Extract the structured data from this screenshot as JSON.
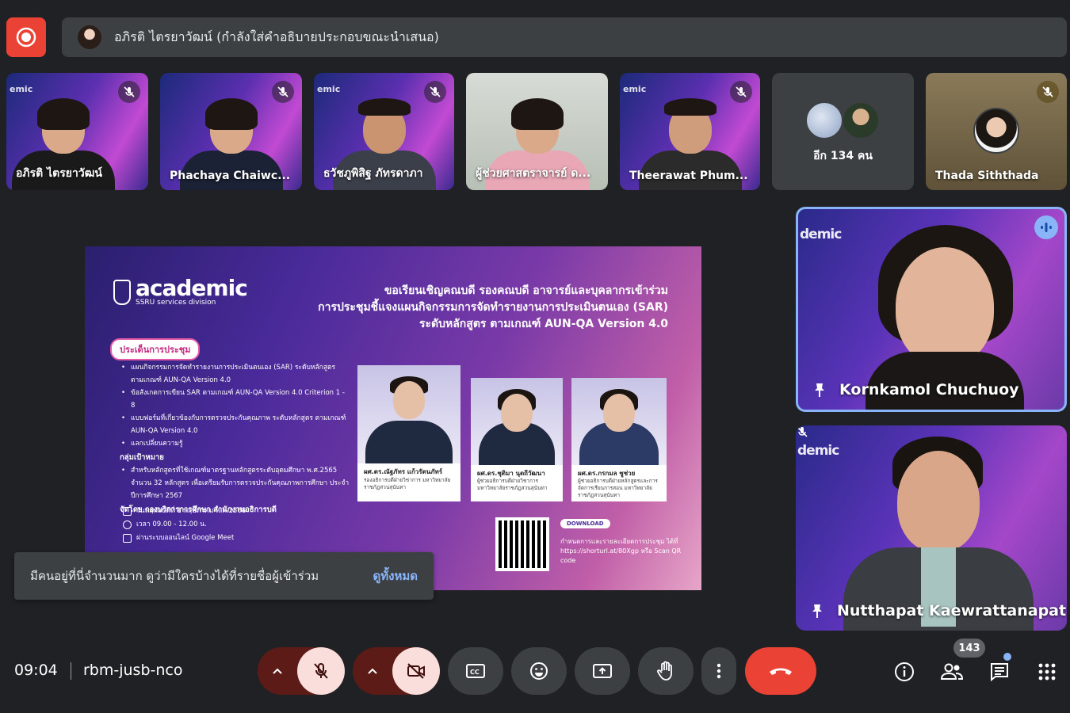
{
  "presenter": {
    "text": "อภิรติ ไตรยาวัฒน์ (กำลังใส่คำอธิบายประกอบขณะนำเสนอ)"
  },
  "tiles": [
    {
      "name": "อภิรติ ไตรยาวัฒน์"
    },
    {
      "name": "Phachaya Chaiwc..."
    },
    {
      "name": "ธวัชภูพิสิฐ ภัทรดาภา"
    },
    {
      "name": "ผู้ช่วยศาสตราจารย์ ด..."
    },
    {
      "name": "Theerawat Phum..."
    },
    {
      "name": "อีก 134 คน"
    },
    {
      "name": "Thada Siththada"
    }
  ],
  "tile_watermark": "emic",
  "big_tiles": [
    {
      "name": "Kornkamol Chuchuoy",
      "watermark": "demic"
    },
    {
      "name": "Nutthapat Kaewrattanapat",
      "watermark": "demic"
    }
  ],
  "slide": {
    "logo_word": "academic",
    "logo_sub": "SSRU services division",
    "headline": [
      "ขอเรียนเชิญคณบดี รองคณบดี อาจารย์และบุคลากรเข้าร่วม",
      "การประชุมชี้แจงแผนกิจกรรมการจัดทำรายงานการประเมินตนเอง (SAR)",
      "ระดับหลักสูตร ตามเกณฑ์ AUN-QA Version 4.0"
    ],
    "pill": "ประเด็นการประชุม",
    "agenda": [
      "แผนกิจกรรมการจัดทำรายงานการประเมินตนเอง (SAR) ระดับหลักสูตร ตามเกณฑ์ AUN-QA Version 4.0",
      "ข้อสังเกตการเขียน SAR ตามเกณฑ์ AUN-QA Version 4.0 Criterion 1 - 8",
      "แบบฟอร์มที่เกี่ยวข้องกับการตรวจประกันคุณภาพ ระดับหลักสูตร ตามเกณฑ์ AUN-QA Version 4.0",
      "แลกเปลี่ยนความรู้"
    ],
    "target_heading": "กลุ่มเป้าหมาย",
    "target": "สำหรับหลักสูตรที่ใช้เกณฑ์มาตรฐานหลักสูตรระดับอุดมศึกษา พ.ศ.2565 จำนวน 32 หลักสูตร เพื่อเตรียมรับการตรวจประกันคุณภาพการศึกษา ประจำปีการศึกษา 2567",
    "organizer": "จัดโดย กองบริการการศึกษา สำนักงานอธิการบดี",
    "date": "วันพฤหัสบดีที่ 1 พฤษภาคม พ.ศ.2568",
    "time": "เวลา 09.00 - 12.00 น.",
    "platform": "ผ่านระบบออนไลน์ Google Meet",
    "speakers": [
      {
        "name": "ผศ.ดร.ณัฐภัทร แก้วรัตนภัทร์",
        "title": "รองอธิการบดีฝ่ายวิชาการ มหาวิทยาลัยราชภัฏสวนสุนันทา"
      },
      {
        "name": "ผศ.ดร.ชุติมา นุตถีวัฒนา",
        "title": "ผู้ช่วยอธิการบดีฝ่ายวิชาการ มหาวิทยาลัยราชภัฏสวนสุนันทา"
      },
      {
        "name": "ผศ.ดร.กรกมล ชูช่วย",
        "title": "ผู้ช่วยอธิการบดีฝ่ายหลักสูตรและการจัดการเรียนการสอน มหาวิทยาลัยราชภัฏสวนสุนันทา"
      }
    ],
    "download": "DOWNLOAD",
    "download_text": "กำหนดการและรายละเอียดการประชุม ได้ที่ https://shorturl.at/80Xgp หรือ Scan QR code"
  },
  "toast": {
    "message": "มีคนอยู่ที่นี่จำนวนมาก ดูว่ามีใครบ้างได้ที่รายชื่อผู้เข้าร่วม",
    "action": "ดูทั้งหมด"
  },
  "meeting": {
    "time": "09:04",
    "code": "rbm-jusb-nco",
    "participants": "143"
  },
  "colors": {
    "background": "#202124",
    "tile": "#3c4043",
    "end_call": "#ea4335",
    "accent": "#8ab4f8",
    "muted_btn": "#f9dedc"
  }
}
